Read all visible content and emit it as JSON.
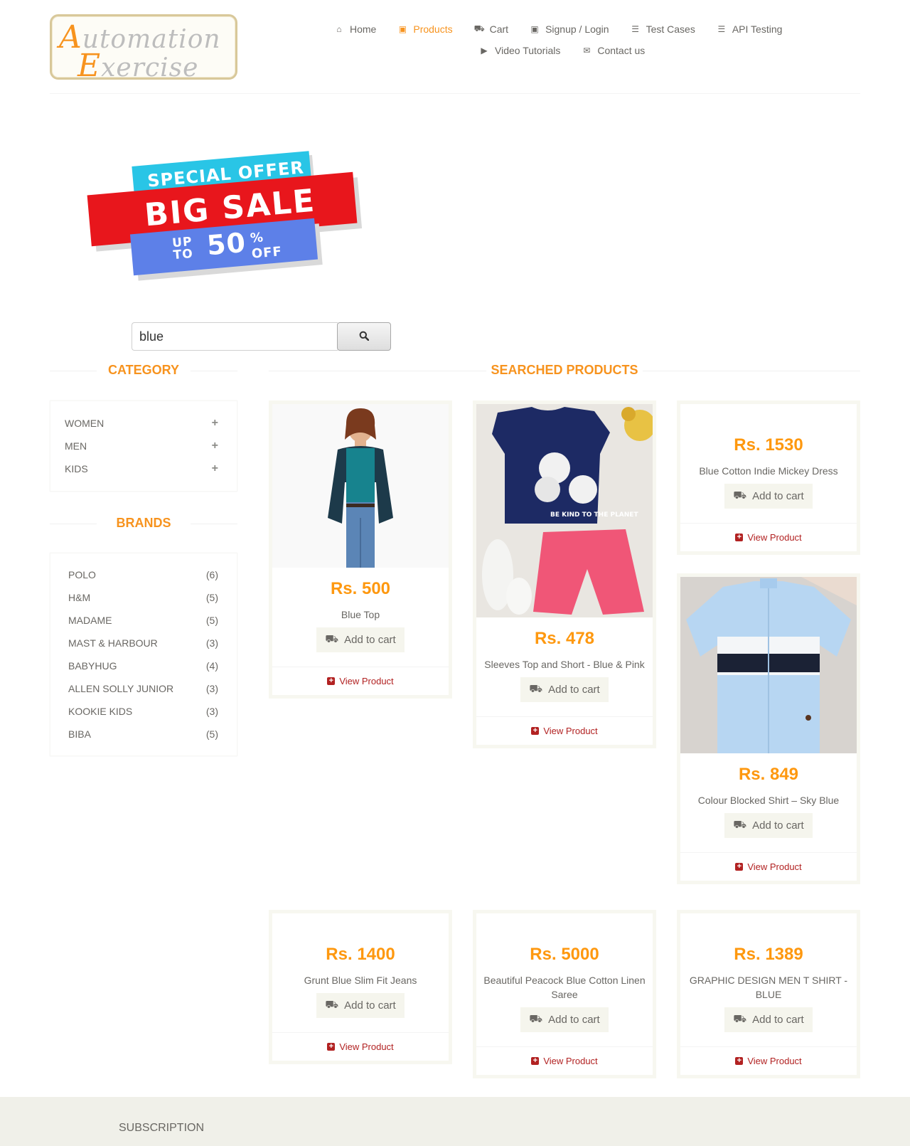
{
  "logo": {
    "line1_cap": "A",
    "line1_rest": "utomation",
    "line2_cap": "E",
    "line2_rest": "xercise"
  },
  "nav": {
    "row1": [
      {
        "label": "Home",
        "icon": "home-icon",
        "glyph": "⌂",
        "active": false
      },
      {
        "label": "Products",
        "icon": "products-icon",
        "glyph": "▣",
        "active": true
      },
      {
        "label": "Cart",
        "icon": "cart-icon",
        "glyph": "⛟",
        "active": false
      },
      {
        "label": "Signup / Login",
        "icon": "lock-icon",
        "glyph": "🔒︎",
        "active": false
      },
      {
        "label": "Test Cases",
        "icon": "list-icon",
        "glyph": "☰",
        "active": false
      },
      {
        "label": "API Testing",
        "icon": "list-icon",
        "glyph": "☰",
        "active": false
      }
    ],
    "row2": [
      {
        "label": "Video Tutorials",
        "icon": "youtube-icon",
        "glyph": "▶",
        "active": false
      },
      {
        "label": "Contact us",
        "icon": "envelope-icon",
        "glyph": "✉",
        "active": false
      }
    ]
  },
  "banner": {
    "special": "SPECIAL OFFER",
    "big": "BIG SALE",
    "up": "UP",
    "to": "TO",
    "fifty": "50",
    "pct": "%",
    "off": "OFF"
  },
  "search": {
    "value": "blue",
    "icon": "search-icon"
  },
  "sidebar": {
    "category_title": "CATEGORY",
    "categories": [
      "WOMEN",
      "MEN",
      "KIDS"
    ],
    "brands_title": "BRANDS",
    "brands": [
      {
        "name": "POLO",
        "count": "(6)"
      },
      {
        "name": "H&M",
        "count": "(5)"
      },
      {
        "name": "MADAME",
        "count": "(5)"
      },
      {
        "name": "MAST & HARBOUR",
        "count": "(3)"
      },
      {
        "name": "BABYHUG",
        "count": "(4)"
      },
      {
        "name": "ALLEN SOLLY JUNIOR",
        "count": "(3)"
      },
      {
        "name": "KOOKIE KIDS",
        "count": "(3)"
      },
      {
        "name": "BIBA",
        "count": "(5)"
      }
    ]
  },
  "main": {
    "title": "SEARCHED PRODUCTS",
    "add_label": "Add to cart",
    "view_label": "View Product",
    "products": [
      {
        "price": "Rs. 500",
        "name": "Blue Top"
      },
      {
        "price": "Rs. 478",
        "name": "Sleeves Top and Short - Blue & Pink"
      },
      {
        "price": "Rs. 1530",
        "name": "Blue Cotton Indie Mickey Dress"
      },
      {
        "price": "Rs. 849",
        "name": "Colour Blocked Shirt – Sky Blue"
      },
      {
        "price": "Rs. 1400",
        "name": "Grunt Blue Slim Fit Jeans"
      },
      {
        "price": "Rs. 5000",
        "name": "Beautiful Peacock Blue Cotton Linen Saree"
      },
      {
        "price": "Rs. 1389",
        "name": "GRAPHIC DESIGN MEN T SHIRT - BLUE"
      }
    ]
  },
  "footer": {
    "subscription": "SUBSCRIPTION"
  },
  "colors": {
    "accent": "#f7931e",
    "price": "#fe980f",
    "view_link": "#b22222"
  }
}
